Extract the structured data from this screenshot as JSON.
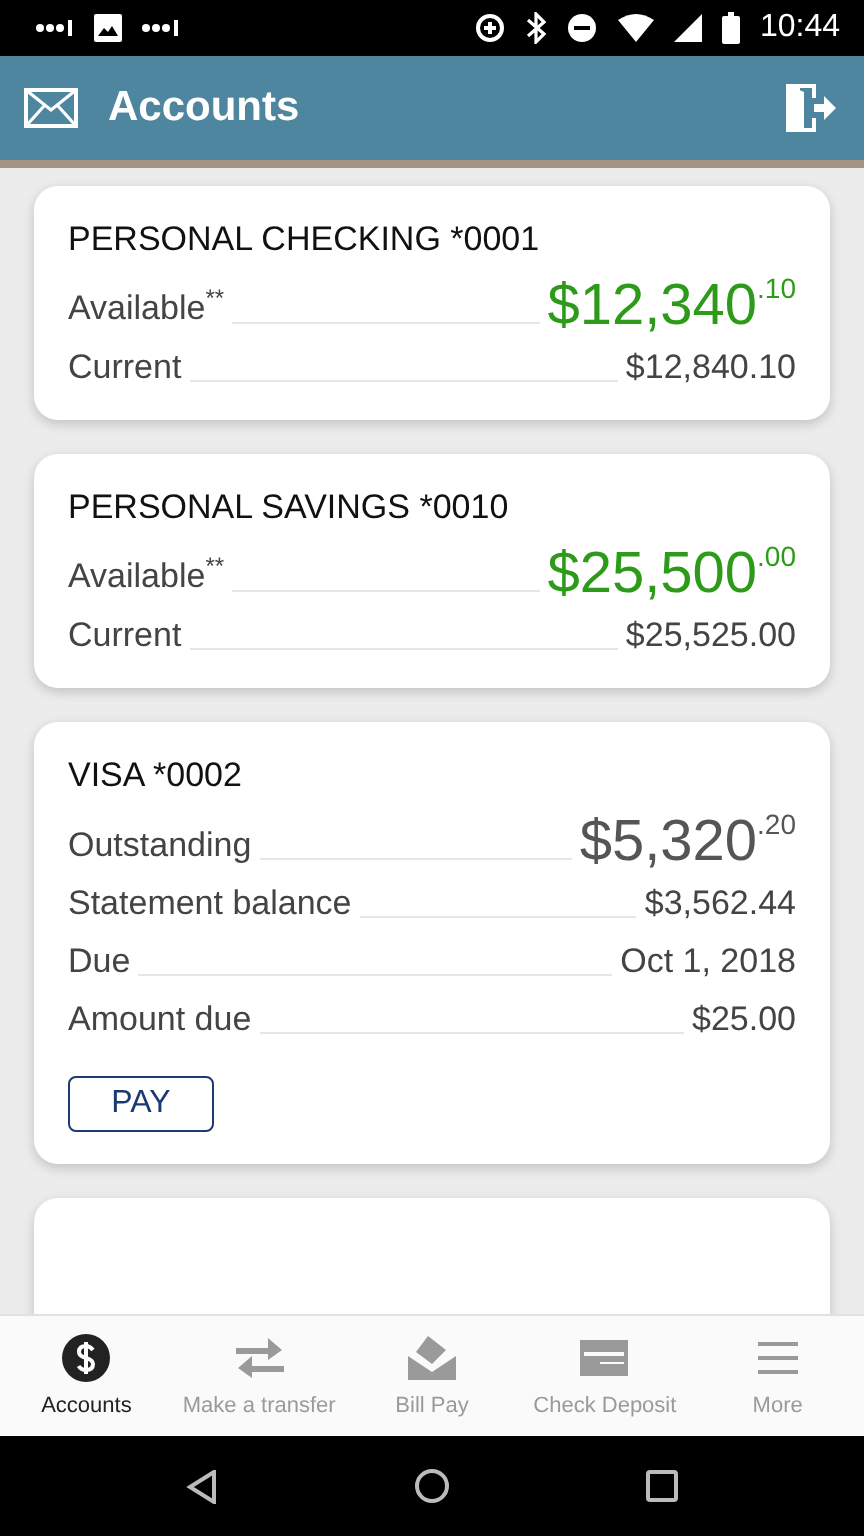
{
  "status_bar": {
    "time": "10:44"
  },
  "app_bar": {
    "title": "Accounts"
  },
  "accounts": [
    {
      "title": "PERSONAL CHECKING *0001",
      "rows": [
        {
          "kind": "big",
          "label": "Available$^{**}$",
          "value": "$12,340$^{.10}$",
          "color": "#2e9a1a"
        },
        {
          "kind": "plain",
          "label": "Current",
          "value": "$12,840.10"
        }
      ]
    },
    {
      "title": "PERSONAL SAVINGS *0010",
      "rows": [
        {
          "kind": "big",
          "label": "Available$^{**}$",
          "value": "$25,500$^{.00}$",
          "color": "#2e9a1a"
        },
        {
          "kind": "plain",
          "label": "Current",
          "value": "$25,525.00"
        }
      ]
    },
    {
      "title": "VISA *0002",
      "rows": [
        {
          "kind": "big",
          "label": "Outstanding",
          "value": "$5,320$^{.20}$",
          "color": "#555555"
        },
        {
          "kind": "plain",
          "label": "Statement balance",
          "value": "$3,562.44"
        },
        {
          "kind": "plain",
          "label": "Due",
          "value": "Oct 1, 2018"
        },
        {
          "kind": "plain",
          "label": "Amount due",
          "value": "$25.00"
        }
      ],
      "actions": [
        "PAY"
      ]
    }
  ],
  "bottom_nav": [
    {
      "label": "Accounts",
      "selected": true
    },
    {
      "label": "Make a transfer",
      "selected": false
    },
    {
      "label": "Bill Pay",
      "selected": false
    },
    {
      "label": "Check Deposit",
      "selected": false
    },
    {
      "label": "More",
      "selected": false
    }
  ]
}
